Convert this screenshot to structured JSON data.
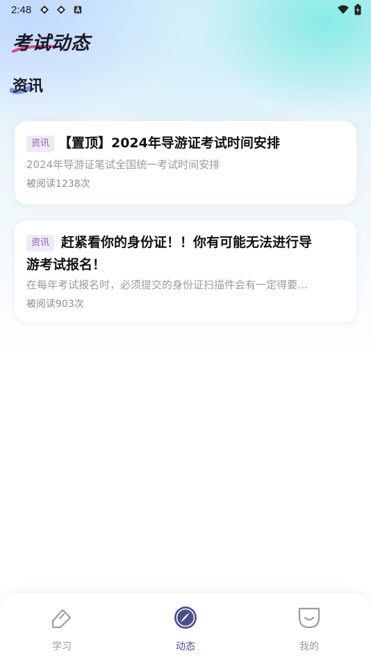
{
  "status_bar": {
    "time": "2:48",
    "icons": [
      "sync-icon",
      "sync-icon",
      "android-a-icon"
    ],
    "right_icons": [
      "wifi-icon",
      "battery-icon"
    ]
  },
  "header": {
    "title": "考试动态",
    "accent_color": "#e0468a"
  },
  "section": {
    "title": "资讯",
    "mark_color": "#6f7fe0"
  },
  "articles": [
    {
      "tag": "资讯",
      "title": "【置顶】2024年导游证考试时间安排",
      "summary": "2024年导游证笔试全国统一考试时间安排",
      "reads": "被阅读1238次"
    },
    {
      "tag": "资讯",
      "title_line1": "赶紧看你的身份证！！你有可能无法进行导",
      "title_line2": "游考试报名！",
      "summary": "在每年考试报名时，必须提交的身份证扫描件会有一定得要…",
      "reads": "被阅读903次"
    }
  ],
  "tabbar": {
    "tabs": [
      {
        "label": "学习",
        "icon": "pencil-icon",
        "active": false
      },
      {
        "label": "动态",
        "icon": "compass-icon",
        "active": true
      },
      {
        "label": "我的",
        "icon": "pocket-icon",
        "active": false
      }
    ],
    "active_color": "#4b4f8f",
    "inactive_color": "#9a9a9a"
  }
}
